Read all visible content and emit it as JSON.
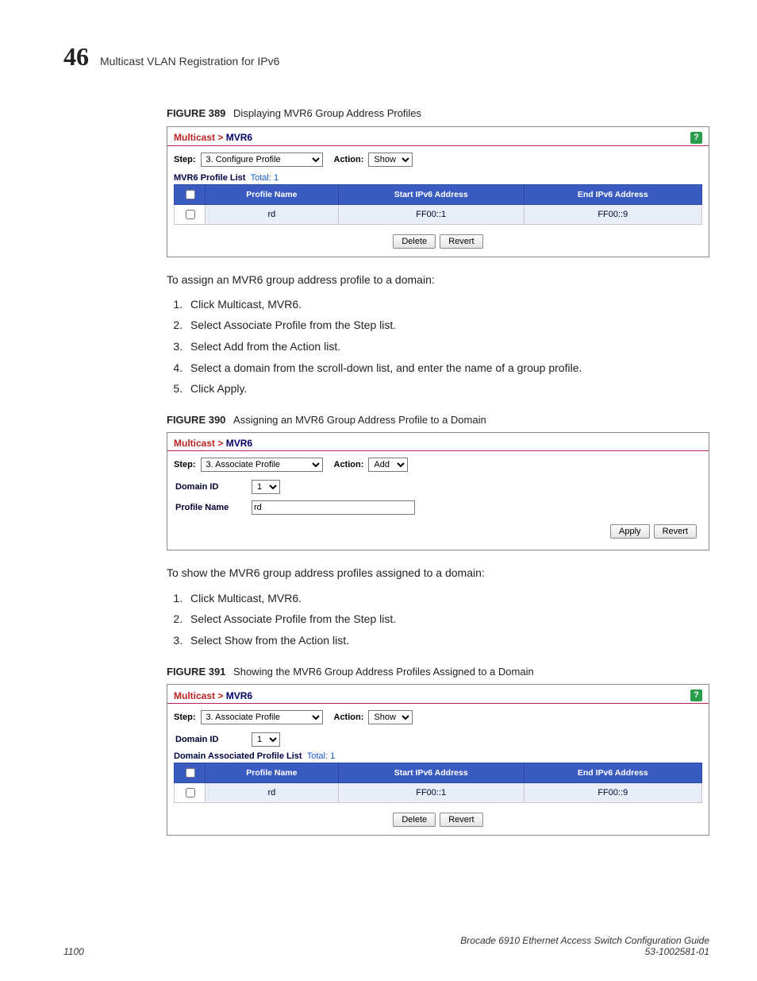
{
  "header": {
    "chapter_num": "46",
    "chapter_title": "Multicast VLAN Registration for IPv6"
  },
  "fig389": {
    "label": "FIGURE 389",
    "title": "Displaying MVR6 Group Address Profiles",
    "breadcrumb_a": "Multicast",
    "breadcrumb_b": "MVR6",
    "step_label": "Step:",
    "step_val": "3. Configure Profile",
    "action_label": "Action:",
    "action_val": "Show",
    "list_label": "MVR6 Profile List",
    "list_total_label": "Total:",
    "list_total": "1",
    "cols": [
      "Profile Name",
      "Start IPv6 Address",
      "End IPv6 Address"
    ],
    "row": {
      "name": "rd",
      "start": "FF00::1",
      "end": "FF00::9"
    },
    "delete": "Delete",
    "revert": "Revert"
  },
  "intro1": "To assign an MVR6 group address profile to a domain:",
  "steps1": [
    "Click Multicast, MVR6.",
    "Select Associate Profile from the Step list.",
    "Select Add from the Action list.",
    "Select a domain from the scroll-down list, and enter the name of a group profile.",
    "Click Apply."
  ],
  "fig390": {
    "label": "FIGURE 390",
    "title": "Assigning an MVR6 Group Address Profile to a Domain",
    "breadcrumb_a": "Multicast",
    "breadcrumb_b": "MVR6",
    "step_label": "Step:",
    "step_val": "3. Associate Profile",
    "action_label": "Action:",
    "action_val": "Add",
    "domain_id_label": "Domain ID",
    "domain_id_val": "1",
    "profile_name_label": "Profile Name",
    "profile_name_val": "rd",
    "apply": "Apply",
    "revert": "Revert"
  },
  "intro2": "To show the MVR6 group address profiles assigned to a domain:",
  "steps2": [
    "Click Multicast, MVR6.",
    "Select Associate Profile from the Step list.",
    "Select Show from the Action list."
  ],
  "fig391": {
    "label": "FIGURE 391",
    "title": "Showing the MVR6 Group Address Profiles Assigned to a Domain",
    "breadcrumb_a": "Multicast",
    "breadcrumb_b": "MVR6",
    "step_label": "Step:",
    "step_val": "3. Associate Profile",
    "action_label": "Action:",
    "action_val": "Show",
    "domain_id_label": "Domain ID",
    "domain_id_val": "1",
    "list_label": "Domain Associated Profile List",
    "list_total_label": "Total:",
    "list_total": "1",
    "cols": [
      "Profile Name",
      "Start IPv6 Address",
      "End IPv6 Address"
    ],
    "row": {
      "name": "rd",
      "start": "FF00::1",
      "end": "FF00::9"
    },
    "delete": "Delete",
    "revert": "Revert"
  },
  "footer": {
    "pagenum": "1100",
    "book": "Brocade 6910 Ethernet Access Switch Configuration Guide",
    "docnum": "53-1002581-01"
  }
}
